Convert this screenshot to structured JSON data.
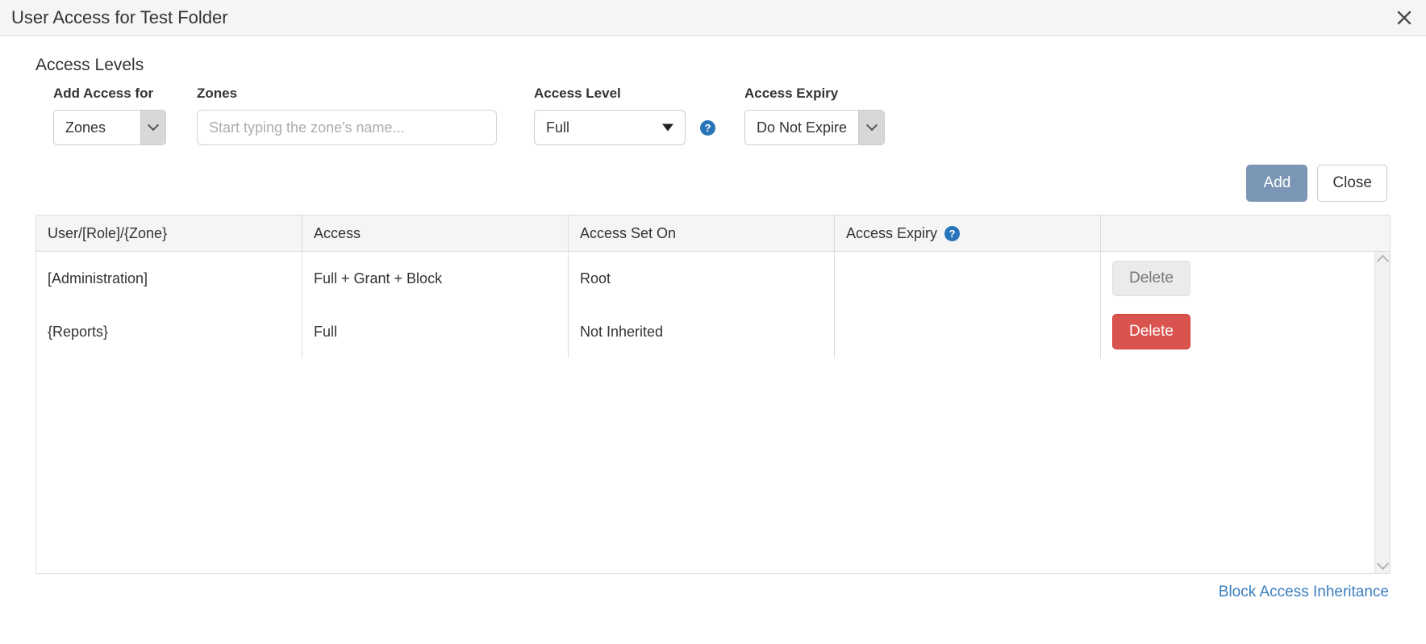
{
  "window": {
    "title": "User Access for Test Folder",
    "close_icon": "close-x-icon"
  },
  "section": {
    "title": "Access Levels"
  },
  "form": {
    "add_access_for": {
      "label": "Add Access for",
      "value": "Zones",
      "icon": "chevron-down-icon"
    },
    "zones": {
      "label": "Zones",
      "value": "",
      "placeholder": "Start typing the zone's name..."
    },
    "access_level": {
      "label": "Access Level",
      "value": "Full",
      "icon": "triangle-down-icon",
      "help_icon": "help-circle-icon",
      "help_glyph": "?"
    },
    "access_expiry": {
      "label": "Access Expiry",
      "value": "Do Not Expire",
      "icon": "chevron-down-icon"
    }
  },
  "actions": {
    "add_label": "Add",
    "close_label": "Close"
  },
  "table": {
    "headers": [
      "User/[Role]/{Zone}",
      "Access",
      "Access Set On",
      "Access Expiry",
      ""
    ],
    "expiry_help_glyph": "?",
    "rows": [
      {
        "user": "[Administration]",
        "access": "Full + Grant + Block",
        "set_on": "Root",
        "expiry": "",
        "delete_label": "Delete",
        "delete_enabled": false
      },
      {
        "user": "{Reports}",
        "access": "Full",
        "set_on": "Not Inherited",
        "expiry": "",
        "delete_label": "Delete",
        "delete_enabled": true
      }
    ],
    "scrollbar": {
      "up_icon": "chevron-up-icon",
      "down_icon": "chevron-down-icon"
    }
  },
  "footer": {
    "link_label": "Block Access Inheritance"
  },
  "colors": {
    "add_button": "#7a96b4",
    "delete_button": "#d9534f",
    "help_icon": "#2874b8",
    "link": "#3a7ebf",
    "header_bg": "#f5f5f5"
  }
}
